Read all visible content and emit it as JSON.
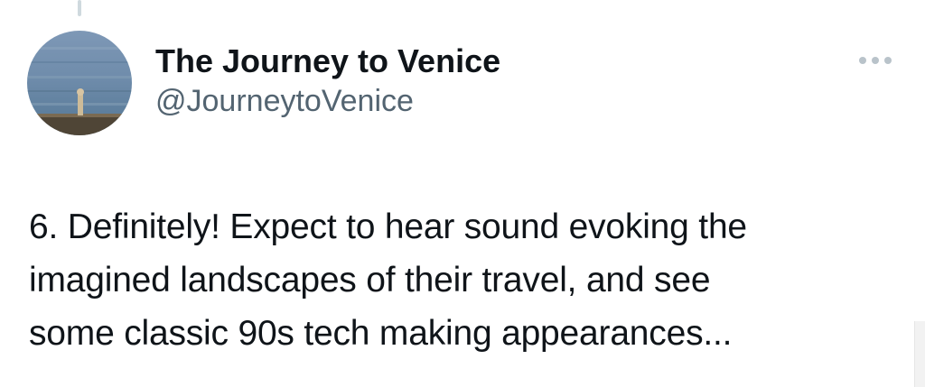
{
  "tweet": {
    "author": {
      "display_name": "The Journey to Venice",
      "handle": "@JourneytoVenice",
      "avatar_icon": "profile-avatar-seascape"
    },
    "more_icon": "more-horizontal-icon",
    "text_lines": [
      "6. Definitely! Expect to hear sound evoking the",
      "imagined landscapes of their travel, and see",
      "some classic 90s tech making appearances..."
    ]
  },
  "colors": {
    "text_primary": "#0f1419",
    "text_secondary": "#536471",
    "thread_line": "#cfd9de",
    "icon_muted": "#b9c3ca"
  }
}
